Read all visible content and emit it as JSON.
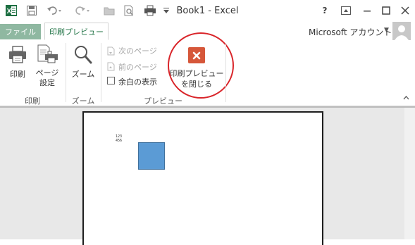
{
  "title_bar": {
    "title": "Book1 - Excel",
    "help": "?",
    "quick_access": [
      "excel-logo",
      "save",
      "undo",
      "redo",
      "open",
      "print-preview",
      "print",
      "customize"
    ]
  },
  "tabs": {
    "file": "ファイル",
    "print_preview": "印刷プレビュー"
  },
  "account": {
    "label": "Microsoft アカウント"
  },
  "ribbon": {
    "print_group": {
      "label": "印刷",
      "print": "印刷",
      "page_setup_1": "ページ",
      "page_setup_2": "設定"
    },
    "zoom_group": {
      "label": "ズーム",
      "zoom": "ズーム"
    },
    "preview_group": {
      "label": "プレビュー",
      "next_page": "次のページ",
      "prev_page": "前のページ",
      "show_margins": "余白の表示",
      "close_1": "印刷プレビュー",
      "close_2": "を閉じる"
    }
  },
  "preview": {
    "cell_row1": "123",
    "cell_row2": "456"
  },
  "colors": {
    "accent": "#217346",
    "close_button": "#d6573a",
    "annotation": "#d9252a",
    "shape_fill": "#5b9bd5"
  }
}
